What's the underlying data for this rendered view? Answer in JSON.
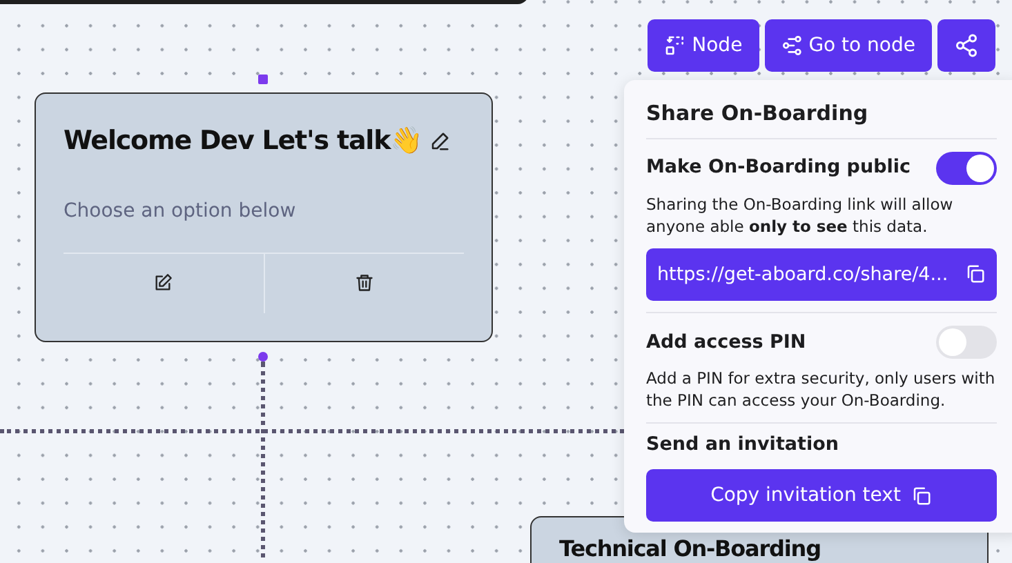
{
  "toolbar": {
    "buttons": [
      {
        "kind": "node",
        "label": "Node"
      },
      {
        "kind": "goto",
        "label": "Go to node"
      },
      {
        "kind": "share"
      }
    ]
  },
  "nodes": [
    {
      "title": "Welcome Dev Let's talk👋",
      "subtitle": "Choose an option below"
    },
    {
      "title": "Technical On-Boarding"
    }
  ],
  "share_panel": {
    "title": "Share On-Boarding",
    "public": {
      "label": "Make On-Boarding public",
      "on": true,
      "description": "Sharing the On-Boarding link will allow anyone able **only to see** this data.",
      "link": "https://get-aboard.co/share/4..."
    },
    "pin": {
      "label": "Add access PIN",
      "on": false,
      "description": "Add a PIN for extra security, only users with the PIN can access your On-Boarding."
    },
    "invitation": {
      "heading": "Send an invitation",
      "button": "Copy invitation text"
    }
  }
}
